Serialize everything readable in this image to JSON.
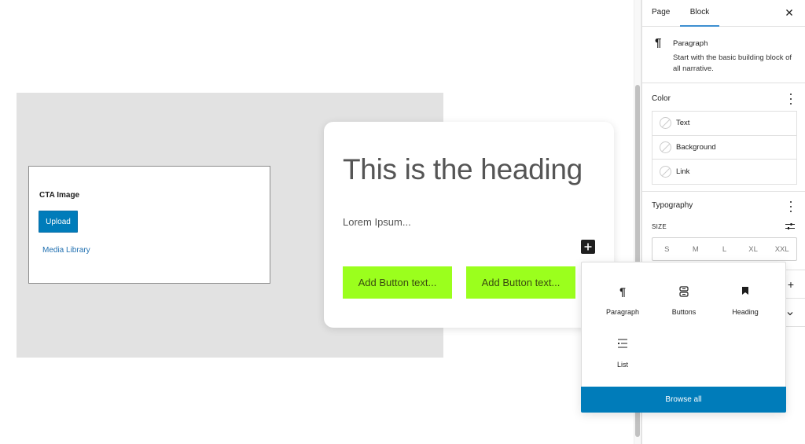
{
  "canvas": {
    "cta": {
      "title": "CTA Image",
      "upload_label": "Upload",
      "media_library_label": "Media Library"
    },
    "card": {
      "heading": "This is the heading",
      "paragraph": "Lorem Ipsum...",
      "buttons": [
        {
          "label": "Add Button text..."
        },
        {
          "label": "Add Button text..."
        }
      ],
      "button_color": "#9bff1d"
    },
    "inserter_icon": "plus-icon"
  },
  "sidebar": {
    "tabs": [
      {
        "label": "Page",
        "active": false
      },
      {
        "label": "Block",
        "active": true
      }
    ],
    "close_icon": "close-icon",
    "block": {
      "icon": "paragraph-icon",
      "name": "Paragraph",
      "description": "Start with the basic building block of all narrative."
    },
    "color": {
      "title": "Color",
      "items": [
        {
          "label": "Text"
        },
        {
          "label": "Background"
        },
        {
          "label": "Link"
        }
      ]
    },
    "typography": {
      "title": "Typography",
      "size_label": "SIZE",
      "sizes": [
        "S",
        "M",
        "L",
        "XL",
        "XXL"
      ]
    },
    "extra_rows": [
      {
        "icon": "plus-icon"
      },
      {
        "icon": "chevron-down-icon"
      }
    ]
  },
  "inserter_popover": {
    "items": [
      {
        "label": "Paragraph",
        "icon": "paragraph-icon"
      },
      {
        "label": "Buttons",
        "icon": "buttons-icon"
      },
      {
        "label": "Heading",
        "icon": "heading-icon"
      },
      {
        "label": "List",
        "icon": "list-icon"
      }
    ],
    "browse_all_label": "Browse all"
  },
  "colors": {
    "accent": "#007cba",
    "tab_indicator": "#3d8fd1"
  }
}
